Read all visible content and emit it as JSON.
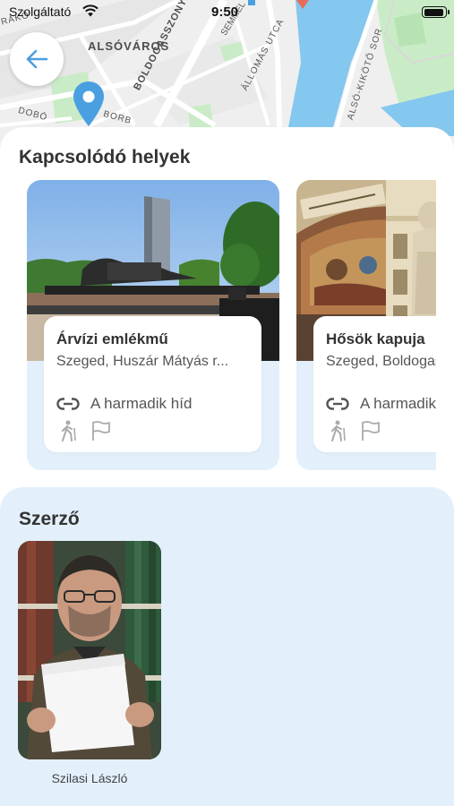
{
  "status_bar": {
    "carrier": "Szolgáltató",
    "time": "9:50",
    "battery_level": 0.95
  },
  "map": {
    "district_label": "ALSÓVÁROS",
    "street_labels": [
      "BOLDOGASSZONY SUG",
      "SEMMEL",
      "ÁLLOMÁS UTCA",
      "ALSÓ-KIKÖTŐ SOR",
      "DOBÓ",
      "BORB",
      "RÁKÓ"
    ],
    "pin_icon": "location-pin-icon",
    "colors": {
      "river": "#84c7ef",
      "park": "#c9ecc6",
      "pin": "#4a9fe0"
    }
  },
  "back_button": {
    "icon": "arrow-left-icon",
    "color": "#4a9fe0"
  },
  "related": {
    "title": "Kapcsolódó helyek",
    "cards": [
      {
        "name": "Árvízi emlékmű",
        "address": "Szeged, Huszár Mátyás r...",
        "link_icon": "link-icon",
        "link_text": "A harmadik híd",
        "badges": [
          "hiker-icon",
          "flag-icon"
        ]
      },
      {
        "name": "Hősök kapuja",
        "address": "Szeged, Boldogasszony sugárút",
        "link_icon": "link-icon",
        "link_text": "A harmadik híd",
        "badges": [
          "hiker-icon",
          "flag-icon"
        ]
      }
    ]
  },
  "author": {
    "title": "Szerző",
    "name": "Szilasi László"
  },
  "colors": {
    "accent": "#4a9fe0",
    "card_background": "#e3f0fb",
    "heading_text": "#333333"
  }
}
